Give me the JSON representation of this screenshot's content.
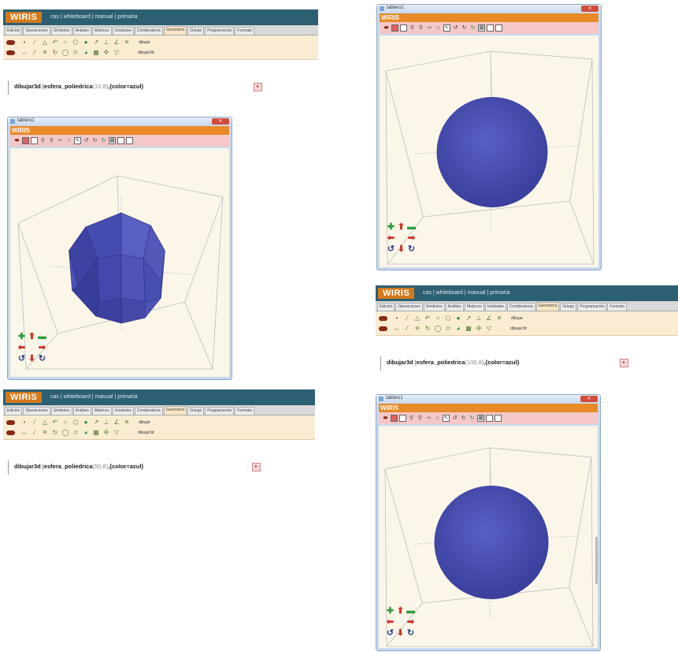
{
  "editors": [
    {
      "logo": "WIRIS",
      "menu": "cas | whiteboard | manual | primaria",
      "tabs": [
        "Edición",
        "Operaciones",
        "Símbolos",
        "Análisis",
        "Matrices",
        "Unidades",
        "Combinatoria",
        "Geometría",
        "Griego",
        "Programación",
        "Formato"
      ],
      "active_tab": "Geometría",
      "tool_labels": [
        "dibujar",
        "dibujar3d"
      ],
      "command_fn": "dibujar3d",
      "command_name": "esfera_poliedrica",
      "command_args": "(10,8)",
      "command_opts": ",{color=azul}"
    },
    {
      "logo": "WIRIS",
      "menu": "cas | whiteboard | manual | primaria",
      "tabs": [
        "Edición",
        "Operaciones",
        "Símbolos",
        "Análisis",
        "Matrices",
        "Unidades",
        "Combinatoria",
        "Geometría",
        "Griego",
        "Programación",
        "Formato"
      ],
      "active_tab": "Geometría",
      "tool_labels": [
        "dibujar",
        "dibujar3d"
      ],
      "command_fn": "dibujar3d",
      "command_name": "esfera_poliedrica",
      "command_args": "(50,8)",
      "command_opts": ",{color=azul}"
    },
    {
      "logo": "WIRIS",
      "menu": "cas | whiteboard | manual | primaria",
      "tabs": [
        "Edición",
        "Operaciones",
        "Símbolos",
        "Análisis",
        "Matrices",
        "Unidades",
        "Combinatoria",
        "Geometría",
        "Griego",
        "Programación",
        "Formato"
      ],
      "active_tab": "Geometría",
      "tool_labels": [
        "dibujar",
        "dibujar3d"
      ],
      "command_fn": "dibujar3d",
      "command_name": "esfera_poliedrica",
      "command_args": "(100,8)",
      "command_opts": ",{color=azul}"
    }
  ],
  "windows": [
    {
      "title": "tablero1",
      "logo": "WIRIS",
      "sphere": "polyhedral"
    },
    {
      "title": "tablero1",
      "logo": "WIRIS",
      "sphere": "smooth"
    },
    {
      "title": "tablero1",
      "logo": "WIRIS",
      "sphere": "smooth"
    }
  ],
  "colors": {
    "sphere": "#4a4fb0",
    "sphere_dark": "#33388f",
    "wiris_orange": "#e98a28",
    "editor_bar": "#2d5f73"
  }
}
